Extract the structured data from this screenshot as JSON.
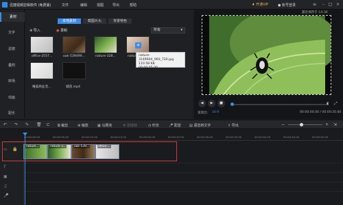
{
  "title_bar": {
    "app_title": "迅捷视频剪辑软件 (免费版)",
    "menu": [
      "文件",
      "编辑",
      "视图",
      "导出",
      "帮助"
    ],
    "vip": "开通VIP",
    "login": "账号登录"
  },
  "sidebar": {
    "items": [
      {
        "label": "素材",
        "active": true
      },
      {
        "label": "文字"
      },
      {
        "label": "滤镜"
      },
      {
        "label": "叠附"
      },
      {
        "label": "转场"
      },
      {
        "label": "动画"
      },
      {
        "label": "配乐"
      }
    ]
  },
  "media_panel": {
    "tabs": [
      "本地素材",
      "截图片头",
      "背景特色"
    ],
    "import_label": "导入",
    "record_label": "录制",
    "filter_value": "所有",
    "items": [
      {
        "label": "office-2557..."
      },
      {
        "label": "oak-539499..."
      },
      {
        "label": "nature-328..."
      },
      {
        "label": "nature-3149"
      },
      {
        "label": "唯美商业活..."
      },
      {
        "label": "城花.mp4"
      }
    ],
    "tooltip": {
      "filename": "nature-3149604_960_720.jpg",
      "size": "110.58 KB",
      "duration": "00:00:05.00"
    }
  },
  "preview": {
    "timecode_top": "最近保存于 14:36",
    "ratio_label": "宽高比:",
    "ratio_value": "16:9",
    "time_display": "00:00:00.00 / 00:00:20.00"
  },
  "toolbar": {
    "items": [
      {
        "label": "裁剪",
        "enabled": true
      },
      {
        "label": "缩放",
        "enabled": true
      },
      {
        "label": "马赛克",
        "enabled": true
      },
      {
        "label": "冻结帧",
        "enabled": false
      },
      {
        "label": "时长",
        "enabled": true
      },
      {
        "label": "配音",
        "enabled": true
      },
      {
        "label": "语音转文字",
        "enabled": true
      },
      {
        "label": "导出",
        "enabled": true
      }
    ]
  },
  "timeline": {
    "ruler": [
      "00:00:00.00",
      "00:00:05.00",
      "00:00:10.00",
      "00:00:15.00",
      "00:00:20.00",
      "00:00:25.00",
      "00:00:30.00",
      "00:00:35.00",
      "00:00:40.00",
      "00:00:45.00",
      "00:00:50.00"
    ],
    "clips": [
      {
        "label": "nature..."
      },
      {
        "label": "nature-3..."
      },
      {
        "label": "oak-539..."
      },
      {
        "label": "office-..."
      }
    ]
  },
  "colors": {
    "accent": "#3d8be8",
    "selection": "#d23a3a",
    "vip": "#e9b447"
  }
}
